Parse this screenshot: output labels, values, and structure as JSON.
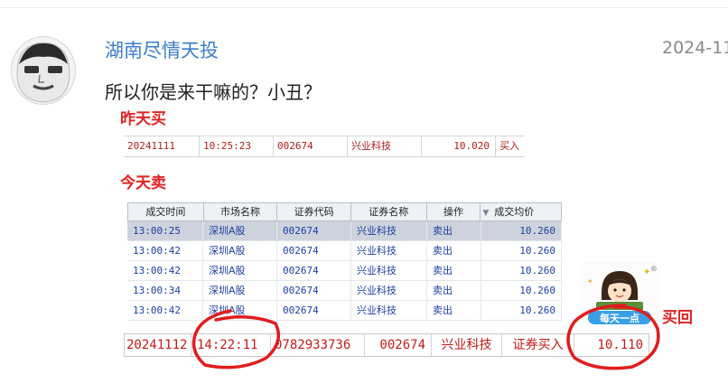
{
  "post": {
    "username": "湖南尽情天投",
    "timestamp": "2024-11",
    "comment": "所以你是来干嘛的？小丑？"
  },
  "labels": {
    "yesterday_buy": "昨天买",
    "today_sell": "今天卖",
    "buy_back": "买回"
  },
  "yesterday_row": [
    "20241111",
    "10:25:23",
    "002674",
    "兴业科技",
    "10.020",
    "买入"
  ],
  "sell_table": {
    "headers": [
      "成交时间",
      "市场名称",
      "证券代码",
      "证券名称",
      "操作",
      "成交均价"
    ],
    "sort_indicator": "▼",
    "rows": [
      [
        "13:00:25",
        "深圳A股",
        "002674",
        "兴业科技",
        "卖出",
        "10.260"
      ],
      [
        "13:00:42",
        "深圳A股",
        "002674",
        "兴业科技",
        "卖出",
        "10.260"
      ],
      [
        "13:00:42",
        "深圳A股",
        "002674",
        "兴业科技",
        "卖出",
        "10.260"
      ],
      [
        "13:00:34",
        "深圳A股",
        "002674",
        "兴业科技",
        "卖出",
        "10.260"
      ],
      [
        "13:00:42",
        "深圳A股",
        "002674",
        "兴业科技",
        "卖出",
        "10.260"
      ]
    ]
  },
  "bottom_row": [
    "20241112",
    "14:22:11",
    "0782933736",
    "002674",
    "兴业科技",
    "证券买入",
    "10.110"
  ],
  "sticker": {
    "text": "每天一点"
  },
  "colors": {
    "username": "#3a7ecb",
    "label_red": "#e02424",
    "table_text": "#1c3fa5",
    "row_red": "#c41a1a"
  }
}
